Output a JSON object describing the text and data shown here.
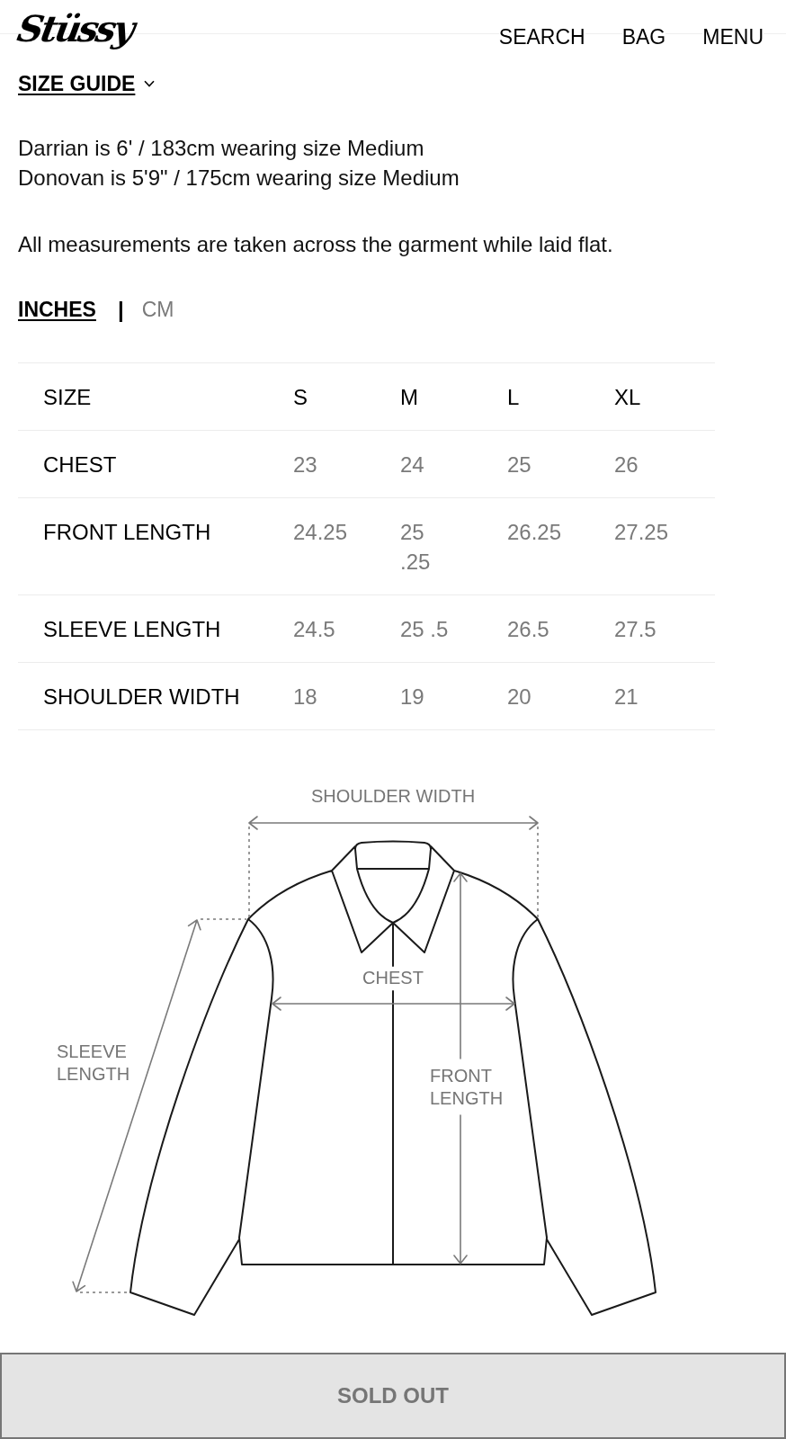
{
  "header": {
    "logo": "Stüssy",
    "nav": [
      "SEARCH",
      "BAG",
      "MENU"
    ]
  },
  "size_guide": {
    "label": "SIZE GUIDE"
  },
  "fit_notes": [
    "Darrian is 6' / 183cm wearing size Medium",
    "Donovan is 5'9\" / 175cm wearing size Medium"
  ],
  "measurement_note": "All measurements are taken across the garment while laid flat.",
  "unit_tabs": {
    "separator": "|",
    "tabs": [
      {
        "label": "INCHES",
        "selected": true
      },
      {
        "label": "CM",
        "selected": false
      }
    ]
  },
  "table": {
    "columns": [
      "SIZE",
      "S",
      "M",
      "L",
      "XL"
    ],
    "rows": [
      {
        "label": "CHEST",
        "values": [
          "23",
          "24",
          "25",
          "26"
        ]
      },
      {
        "label": "FRONT LENGTH",
        "values": [
          "24.25",
          "25\n.25",
          "26.25",
          "27.25"
        ]
      },
      {
        "label": "SLEEVE LENGTH",
        "values": [
          "24.5",
          "25 .5",
          "26.5",
          "27.5"
        ]
      },
      {
        "label": "SHOULDER WIDTH",
        "values": [
          "18",
          "19",
          "20",
          "21"
        ]
      }
    ]
  },
  "diagram": {
    "measurements": [
      {
        "kind": "shoulder_width",
        "label": "SHOULDER WIDTH"
      },
      {
        "kind": "chest",
        "label": "CHEST"
      },
      {
        "kind": "sleeve_length",
        "label": "SLEEVE LENGTH"
      },
      {
        "kind": "front_length",
        "label": "FRONT LENGTH"
      }
    ]
  },
  "buy_button": {
    "label": "SOLD OUT",
    "disabled": true
  }
}
